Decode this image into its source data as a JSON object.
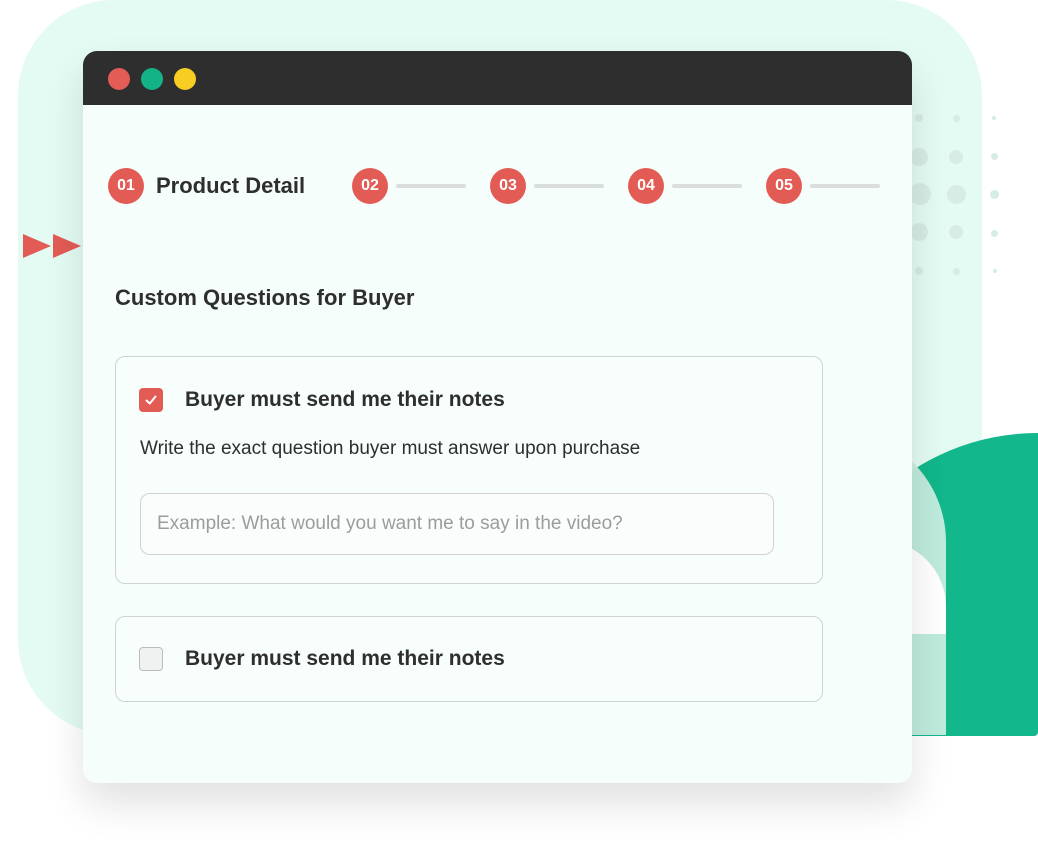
{
  "window": {
    "controls": [
      "close",
      "minimize",
      "maximize"
    ]
  },
  "stepper": {
    "steps": [
      {
        "number": "01",
        "label": "Product Detail",
        "active": true
      },
      {
        "number": "02",
        "label": "",
        "active": false
      },
      {
        "number": "03",
        "label": "",
        "active": false
      },
      {
        "number": "04",
        "label": "",
        "active": false
      },
      {
        "number": "05",
        "label": "",
        "active": false
      }
    ]
  },
  "content": {
    "section_title": "Custom Questions for Buyer",
    "questions": [
      {
        "checked": true,
        "label": "Buyer must send me their notes",
        "helper": "Write the exact question buyer must answer upon purchase",
        "input_placeholder": "Example: What would you want me to say in the video?",
        "input_value": ""
      },
      {
        "checked": false,
        "label": "Buyer must send me their notes"
      }
    ]
  },
  "colors": {
    "accent": "#e35b55",
    "titlebar": "#2e2e2e",
    "green": "#14b387",
    "yellow": "#f6cd20",
    "background_mint": "#e3fbf3"
  },
  "icons": [
    "check-icon",
    "play-arrow-icon"
  ]
}
